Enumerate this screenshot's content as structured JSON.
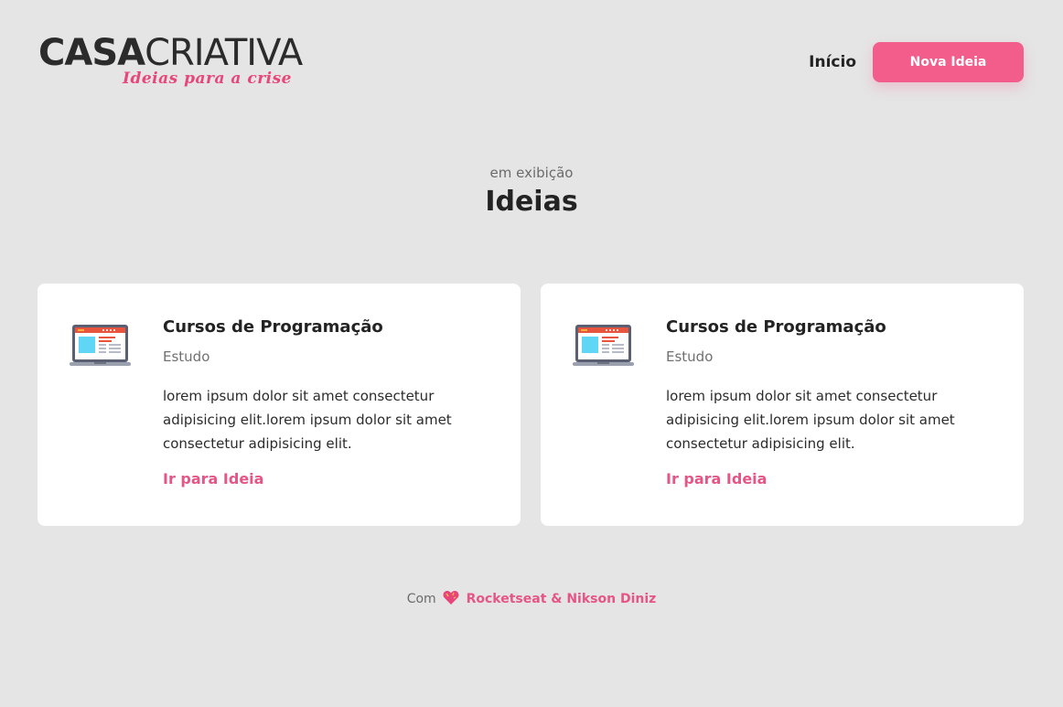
{
  "header": {
    "logo": {
      "part1": "CASA",
      "part2": "CRIATIVA",
      "tagline": "Ideias para a crise"
    },
    "nav": {
      "home_label": "Início",
      "new_idea_label": "Nova Ideia"
    }
  },
  "section": {
    "eyebrow": "em exibição",
    "title": "Ideias"
  },
  "ideas": [
    {
      "title": "Cursos de Programação",
      "category": "Estudo",
      "description": "lorem ipsum dolor sit amet consectetur adipisicing elit.lorem ipsum dolor sit amet consectetur adipisicing elit.",
      "link_label": "Ir para Ideia",
      "icon": "laptop-icon"
    },
    {
      "title": "Cursos de Programação",
      "category": "Estudo",
      "description": "lorem ipsum dolor sit amet consectetur adipisicing elit.lorem ipsum dolor sit amet consectetur adipisicing elit.",
      "link_label": "Ir para Ideia",
      "icon": "laptop-icon"
    }
  ],
  "footer": {
    "prefix": "Com",
    "credits": "Rocketseat & Nikson Diniz",
    "icon": "heart-icon"
  },
  "colors": {
    "accent": "#f25d8b",
    "link": "#e55585",
    "background": "#e5e5e5",
    "card": "#ffffff"
  }
}
